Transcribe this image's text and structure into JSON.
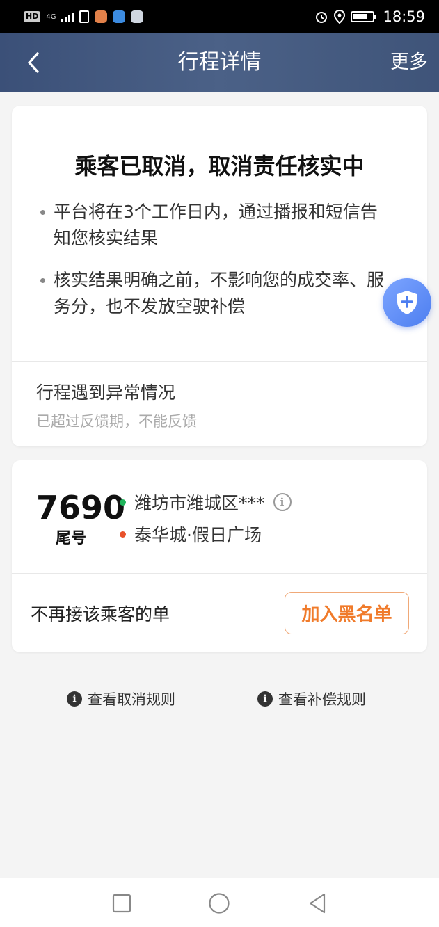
{
  "status_bar": {
    "network_badge": "HD",
    "network_type": "4G",
    "time": "18:59"
  },
  "header": {
    "title": "行程详情",
    "more_label": "更多"
  },
  "status_card": {
    "title": "乘客已取消，取消责任核实中",
    "bullets": [
      "平台将在3个工作日内，通过播报和短信告知您核实结果",
      "核实结果明确之前，不影响您的成交率、服务分，也不发放空驶补偿"
    ],
    "exception_title": "行程遇到异常情况",
    "exception_subtitle": "已超过反馈期，不能反馈"
  },
  "trip_card": {
    "tail_number": "7690",
    "tail_label": "尾号",
    "origin": "潍坊市潍城区***",
    "destination": "泰华城·假日广场",
    "block_label": "不再接该乘客的单",
    "blacklist_button": "加入黑名单"
  },
  "rules": {
    "cancel_rules": "查看取消规则",
    "compensation_rules": "查看补偿规则"
  },
  "colors": {
    "header_bg": "#3f5479",
    "origin_dot": "#1fb35b",
    "destination_dot": "#e8512a",
    "accent_orange": "#f07b2b",
    "shield_blue": "#4d7ef0"
  },
  "icons": {
    "back": "chevron-left-icon",
    "shield": "shield-plus-icon",
    "info": "info-icon",
    "nav_recent": "square-icon",
    "nav_home": "circle-icon",
    "nav_back": "triangle-back-icon"
  }
}
